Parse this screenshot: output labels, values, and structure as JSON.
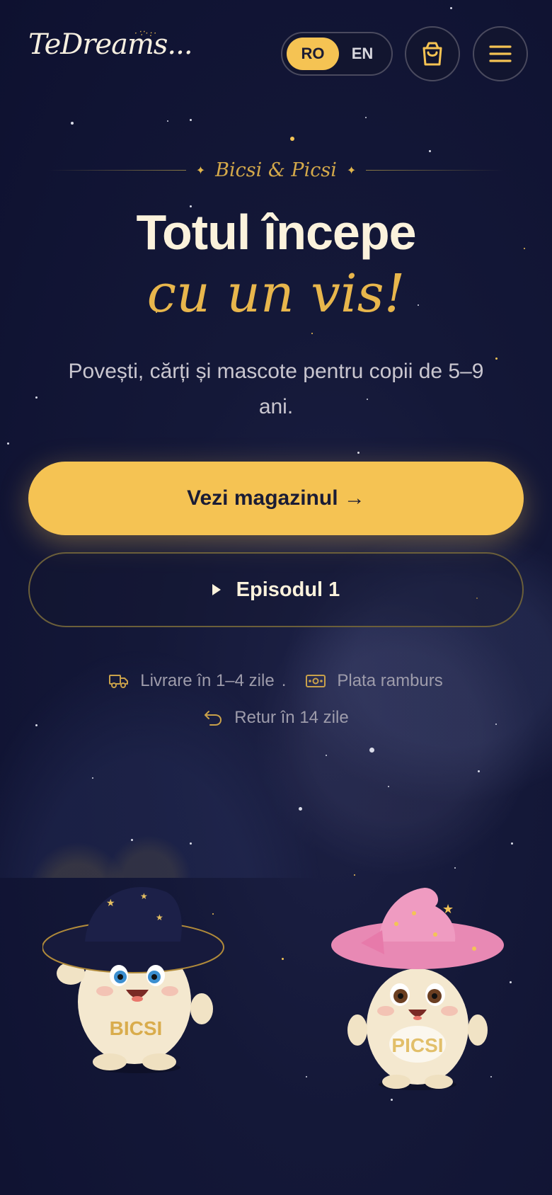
{
  "header": {
    "logo_text": "TeDreams...",
    "languages": [
      "RO",
      "EN"
    ],
    "active_language": "RO",
    "cart_icon": "shopping-bag-icon",
    "menu_icon": "hamburger-menu-icon"
  },
  "hero": {
    "eyebrow": "Bicsi & Picsi",
    "title_line1": "Totul începe",
    "title_line2": "cu un vis!",
    "subtitle": "Povești, cărți și mascote pentru copii de 5–9 ani.",
    "primary_cta": "Vezi magazinul →",
    "secondary_cta": "Episodul 1"
  },
  "perks": [
    {
      "icon": "truck-icon",
      "label": "Livrare în 1–4 zile"
    },
    {
      "icon": "cash-icon",
      "label": "Plata ramburs"
    },
    {
      "icon": "return-arrow-icon",
      "label": "Retur în 14 zile"
    }
  ],
  "mascots": [
    {
      "name": "BICSI"
    },
    {
      "name": "PICSI"
    }
  ],
  "colors": {
    "accent": "#f5c353",
    "background": "#141838",
    "text_light": "#fbf2dc",
    "gold_script": "#e8b64c"
  }
}
